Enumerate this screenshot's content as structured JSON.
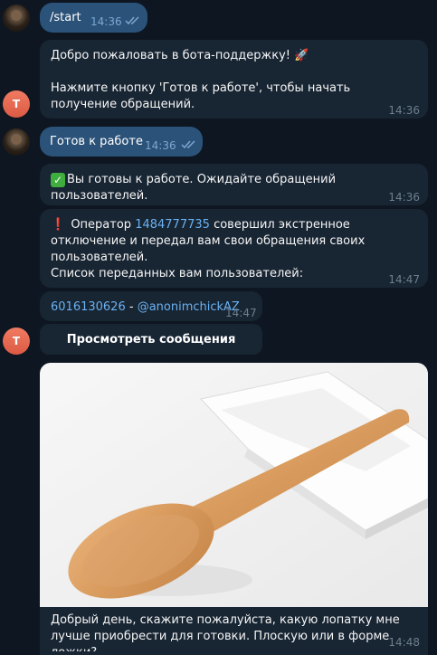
{
  "messages": {
    "start_cmd": {
      "text": "/start",
      "time": "14:36"
    },
    "welcome": {
      "line1": "Добро пожаловать в бота-поддержку!",
      "line2": "Нажмите кнопку 'Готов к работе', чтобы начать получение обращений.",
      "time": "14:36",
      "emoji_icon": "rocket-icon"
    },
    "ready_cmd": {
      "text": "Готов к работе",
      "time": "14:36"
    },
    "ready_reply": {
      "text": "Вы готовы к работе. Ожидайте обращений пользователей.",
      "time": "14:36"
    },
    "operator": {
      "prefix": "Оператор",
      "operator_id": "1484777735",
      "suffix": "совершил экстренное отключение и передал вам свои обращения своих пользователей.",
      "list_title": "Список переданных вам пользователей:",
      "time": "14:47"
    },
    "user_entry": {
      "user_id": "6016130626",
      "separator": " - ",
      "username": "@anonimchickAZ",
      "time": "14:47"
    },
    "view_button": "Просмотреть сообщения",
    "photo_message": {
      "caption": "Добрый день, скажите пожалуйста, какую лопатку мне лучше приобрести для готовки. Плоскую или в форме ложки?",
      "time": "14:48"
    }
  },
  "avatars": {
    "bot_letter": "T"
  },
  "colors": {
    "background": "#0e1621",
    "incoming_bubble": "#182533",
    "outgoing_bubble": "#2b5278",
    "link": "#6ab2f2",
    "avatar_letter_bg": "#e56a54"
  }
}
